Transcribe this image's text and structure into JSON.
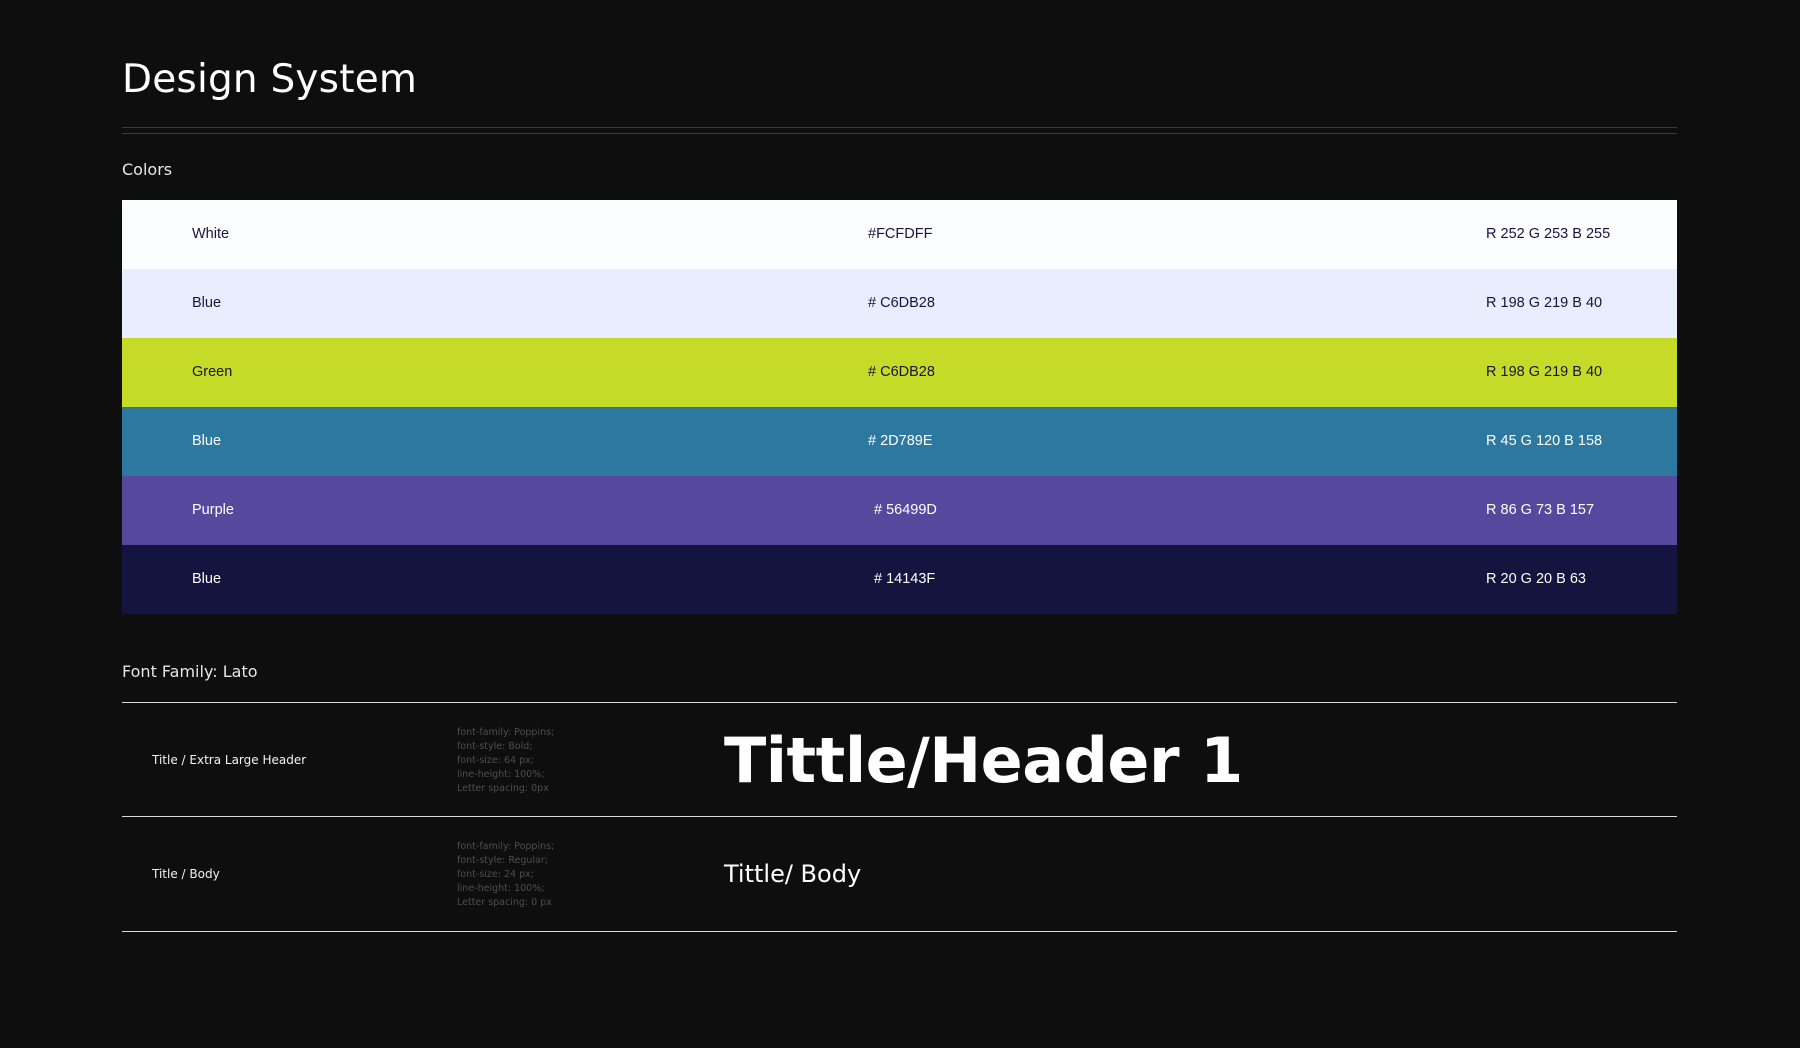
{
  "page": {
    "title": "Design System"
  },
  "colors": {
    "section_label": "Colors",
    "rows": [
      {
        "name": "White",
        "hex": "#FCFDFF",
        "rgb": "R 252 G 253 B 255",
        "bg": "#FCFDFF",
        "text_color": "#14143F"
      },
      {
        "name": "Blue",
        "hex": "# C6DB28",
        "rgb": "R 198 G 219 B 40",
        "bg": "#E8EEFE",
        "text_color": "#14143F"
      },
      {
        "name": "Green",
        "hex": "# C6DB28",
        "rgb": "R 198 G 219 B 40",
        "bg": "#C6DB28",
        "text_color": "#14143F"
      },
      {
        "name": "Blue",
        "hex": "# 2D789E",
        "rgb": "R 45 G 120 B 158",
        "bg": "#2D789E",
        "text_color": "#FFFFFF"
      },
      {
        "name": "Purple",
        "hex": "# 56499D",
        "rgb": "R 86 G 73 B 157",
        "bg": "#56499D",
        "text_color": "#FFFFFF"
      },
      {
        "name": "Blue",
        "hex": "# 14143F",
        "rgb": "R 20 G 20 B 63",
        "bg": "#14143F",
        "text_color": "#FFFFFF"
      }
    ]
  },
  "typography": {
    "section_label": "Font Family: Lato",
    "styles": [
      {
        "name": "Title / Extra Large Header",
        "specs": [
          "font-family: Poppins;",
          "font-style: Bold;",
          "font-size: 64 px;",
          "line-height: 100%;",
          "Letter spacing: 0px"
        ],
        "sample": "Tittle/Header 1"
      },
      {
        "name": "Title / Body",
        "specs": [
          "font-family: Poppins;",
          "font-style: Regular;",
          "font-size: 24 px;",
          "line-height: 100%;",
          "Letter spacing: 0 px"
        ],
        "sample": "Tittle/ Body"
      }
    ]
  }
}
